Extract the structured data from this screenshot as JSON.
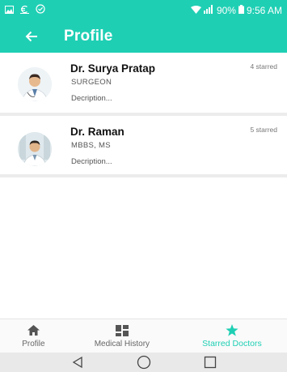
{
  "status_bar": {
    "battery": "90%",
    "time": "9:56 AM"
  },
  "app_bar": {
    "title": "Profile"
  },
  "doctors": [
    {
      "name": "Dr. Surya Pratap",
      "specialty": "SURGEON",
      "description": "Decription...",
      "stars": "4 starred"
    },
    {
      "name": "Dr. Raman",
      "specialty": "MBBS, MS",
      "description": "Decription...",
      "stars": "5 starred"
    }
  ],
  "bottom_nav": {
    "items": [
      {
        "label": "Profile",
        "icon": "home-icon",
        "active": false
      },
      {
        "label": "Medical History",
        "icon": "dashboard-icon",
        "active": false
      },
      {
        "label": "Starred Doctors",
        "icon": "star-icon",
        "active": true
      }
    ]
  },
  "colors": {
    "primary": "#1fcfb4",
    "active_tab": "#1fcfb4"
  }
}
